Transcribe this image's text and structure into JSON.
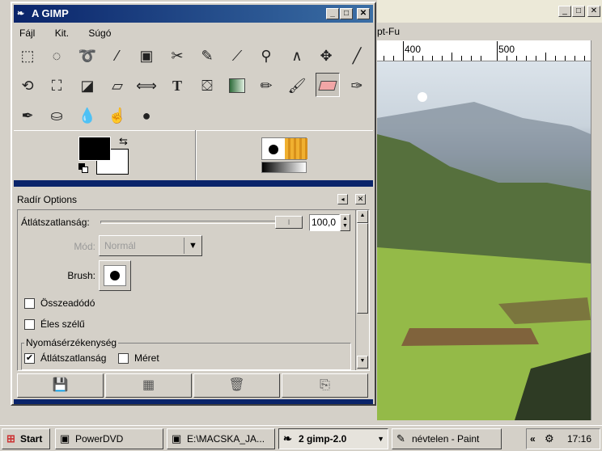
{
  "background_window": {
    "menu_partial": "pt-Fu",
    "ruler_labels": [
      "400",
      "500"
    ]
  },
  "toolbox": {
    "title": "A GIMP",
    "menu": [
      "Fájl",
      "Kit.",
      "Súgó"
    ],
    "tools_row1": [
      "rect-select-icon",
      "ellipse-select-icon",
      "lasso-icon",
      "magic-wand-icon",
      "select-by-color-icon",
      "scissors-icon",
      "paths-icon",
      "color-picker-icon",
      "magnify-icon",
      "measure-icon",
      "move-icon",
      "knife-icon"
    ],
    "tools_row2": [
      "rotate-icon",
      "crop-icon",
      "perspective-icon",
      "shear-icon",
      "flip-icon",
      "text-icon",
      "bucket-fill-icon",
      "blend-icon",
      "pencil-icon",
      "paintbrush-icon",
      "eraser-icon",
      "airbrush-icon"
    ],
    "tools_row3": [
      "ink-icon",
      "clone-icon",
      "blur-icon",
      "smudge-icon",
      "dodge-burn-icon"
    ],
    "colors": {
      "foreground": "#000000",
      "background": "#ffffff"
    }
  },
  "options": {
    "title": "Radír Options",
    "opacity_label": "Átlátszatlanság:",
    "opacity_value": "100,0",
    "mode_label": "Mód:",
    "mode_value": "Normál",
    "brush_label": "Brush:",
    "additive_label": "Összeadódó",
    "hard_edge_label": "Éles szélű",
    "pressure_group": "Nyomásérzékenység",
    "pressure_opacity_label": "Átlátszatlanság",
    "pressure_size_label": "Méret",
    "pressure_opacity_checked": true,
    "pressure_size_checked": false,
    "additive_checked": false,
    "hard_edge_checked": false
  },
  "taskbar": {
    "start": "Start",
    "items": [
      "PowerDVD",
      "E:\\MACSKA_JA...",
      "2 gimp-2.0",
      "névtelen - Paint"
    ],
    "clock": "17:16",
    "chevron": "«"
  }
}
